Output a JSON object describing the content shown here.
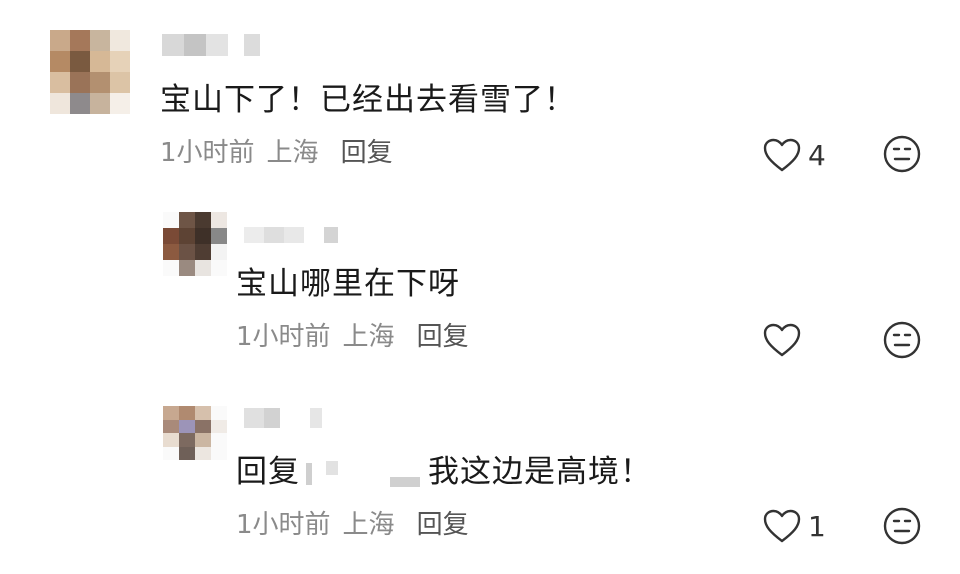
{
  "comments": [
    {
      "text": "宝山下了！已经出去看雪了！",
      "time": "1小时前",
      "location": "上海",
      "reply_label": "回复",
      "like_count": "4"
    },
    {
      "text": "宝山哪里在下呀",
      "time": "1小时前",
      "location": "上海",
      "reply_label": "回复",
      "like_count": ""
    },
    {
      "text_prefix": "回复",
      "text": "我这边是高境！",
      "time": "1小时前",
      "location": "上海",
      "reply_label": "回复",
      "like_count": "1"
    }
  ],
  "icons": {
    "like": "heart-outline-icon",
    "react": "meh-face-icon"
  },
  "colors": {
    "text": "#1a1a1a",
    "meta": "#8a8a8a",
    "icon": "#333333"
  }
}
